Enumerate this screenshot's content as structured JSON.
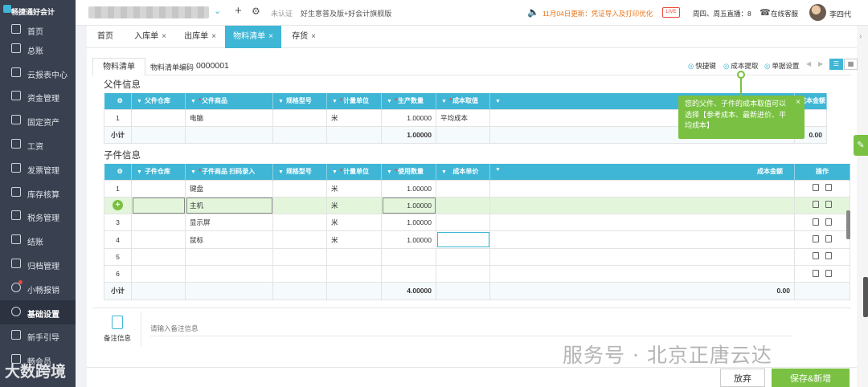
{
  "app": {
    "logo_text": "畅捷通好会计",
    "notice": "11月04日更新：凭证导入及打印优化",
    "live": "周四、周五直播：8",
    "service": "在线客服",
    "username": "李四代",
    "cert": "未认证",
    "product": "好生意普及版+好会计旗舰版"
  },
  "sidebar": {
    "items": [
      {
        "label": "首页"
      },
      {
        "label": "总账"
      },
      {
        "label": "云报表中心"
      },
      {
        "label": "资金管理"
      },
      {
        "label": "固定资产"
      },
      {
        "label": "工资"
      },
      {
        "label": "发票管理"
      },
      {
        "label": "库存核算"
      },
      {
        "label": "税务管理"
      },
      {
        "label": "结账"
      },
      {
        "label": "归档管理"
      },
      {
        "label": "小畅报销"
      },
      {
        "label": "基础设置"
      },
      {
        "label": "新手引导"
      },
      {
        "label": "畅会员"
      }
    ]
  },
  "tabs": [
    {
      "label": "首页",
      "close": ""
    },
    {
      "label": "入库单",
      "close": "×"
    },
    {
      "label": "出库单",
      "close": "×"
    },
    {
      "label": "物料清单",
      "close": "×"
    },
    {
      "label": "存货",
      "close": "×"
    }
  ],
  "page": {
    "subtab": "物料清单",
    "code_label": "物料清单编码",
    "code_value": "0000001",
    "tools": {
      "shortcut": "快捷键",
      "cost_fetch": "成本提取",
      "doc_settings": "单据设置"
    },
    "parent_title": "父件信息",
    "child_title": "子件信息"
  },
  "parent_table": {
    "headers": [
      "父件仓库",
      "父件商品",
      "规格型号",
      "计量单位",
      "生产数量",
      "成本取值",
      "",
      "成本金额"
    ],
    "rows": [
      {
        "no": "1",
        "warehouse": "",
        "product": "电脑",
        "spec": "",
        "unit": "米",
        "qty": "1.00000",
        "cost_method": "平均成本",
        "amount": ""
      }
    ],
    "subtotal": {
      "label": "小计",
      "qty": "1.00000",
      "amount": "0.00"
    }
  },
  "child_table": {
    "headers": [
      "子件仓库",
      "子件商品",
      "扫码录入",
      "规格型号",
      "计量单位",
      "使用数量",
      "成本单价",
      "成本金额",
      "操作"
    ],
    "rows": [
      {
        "no": "1",
        "product": "键盘",
        "unit": "米",
        "qty": "1.00000"
      },
      {
        "no": "+",
        "product": "主机",
        "unit": "米",
        "qty": "1.00000"
      },
      {
        "no": "3",
        "product": "显示屏",
        "unit": "米",
        "qty": "1.00000"
      },
      {
        "no": "4",
        "product": "鼠标",
        "unit": "米",
        "qty": "1.00000"
      },
      {
        "no": "5",
        "product": "",
        "unit": "",
        "qty": ""
      },
      {
        "no": "6",
        "product": "",
        "unit": "",
        "qty": ""
      }
    ],
    "subtotal": {
      "label": "小计",
      "qty": "4.00000",
      "amount": "0.00"
    }
  },
  "tooltip": {
    "text": "您的父件、子件的成本取值可以选择【参考成本、最新进价、平均成本】",
    "close": "×"
  },
  "notes": {
    "label": "备注信息",
    "placeholder": "请输入备注信息"
  },
  "footer": {
    "abandon": "放弃",
    "save_new": "保存&新增"
  },
  "watermarks": {
    "right": "服务号 · 北京正唐云达",
    "left": "大数跨境"
  },
  "colors": {
    "accent": "#3fb6d6",
    "green": "#7ac143",
    "sidebar": "#39404f",
    "notice": "#e8751a"
  }
}
